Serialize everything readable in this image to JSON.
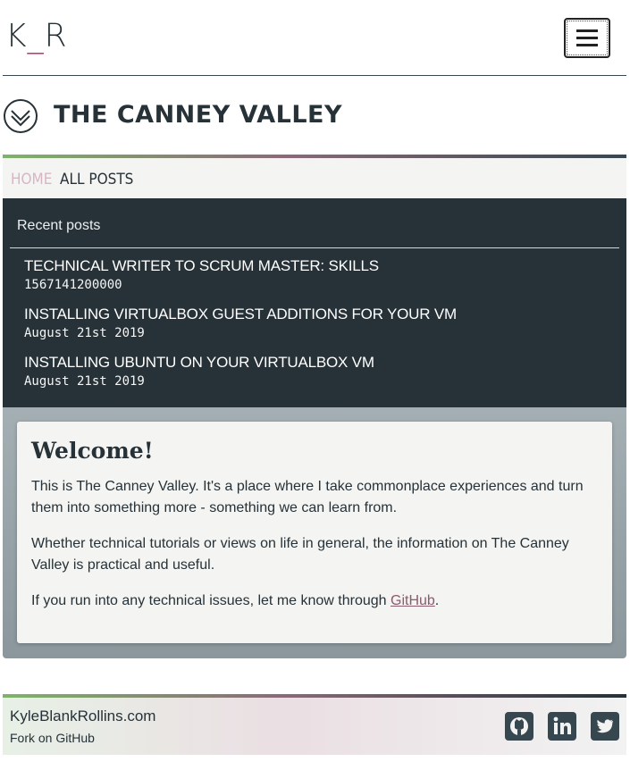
{
  "header": {
    "logo_left": "K",
    "logo_sep": "_",
    "logo_right": "R",
    "menu_icon": "hamburger-icon"
  },
  "site": {
    "title": "THE CANNEY VALLEY",
    "icon": "chevron-badge-icon"
  },
  "nav": {
    "items": [
      {
        "label": "HOME"
      },
      {
        "label": "ALL POSTS"
      }
    ]
  },
  "recent": {
    "heading": "Recent posts",
    "posts": [
      {
        "title": "TECHNICAL WRITER TO SCRUM MASTER: SKILLS",
        "date": "1567141200000"
      },
      {
        "title": "INSTALLING VIRTUALBOX GUEST ADDITIONS FOR YOUR VM",
        "date": "August 21st 2019"
      },
      {
        "title": "INSTALLING UBUNTU ON YOUR VIRTUALBOX VM",
        "date": "August 21st 2019"
      }
    ]
  },
  "main": {
    "heading": "Welcome!",
    "p1": "This is The Canney Valley. It's a place where I take commonplace experiences and turn them into something more - something we can learn from.",
    "p2": "Whether technical tutorials or views on life in general, the information on The Canney Valley is practical and useful.",
    "p3_before": "If you run into any technical issues, let me know through ",
    "p3_link": "GitHub",
    "p3_after": "."
  },
  "footer": {
    "site": "KyleBlankRollins.com",
    "fork": "Fork on GitHub",
    "icons": [
      "github-icon",
      "linkedin-icon",
      "twitter-icon"
    ]
  },
  "colors": {
    "dark": "#263238",
    "accent_pink": "#c2185b",
    "link": "#8a5a6e",
    "nav_home": "#d7b6c3"
  }
}
